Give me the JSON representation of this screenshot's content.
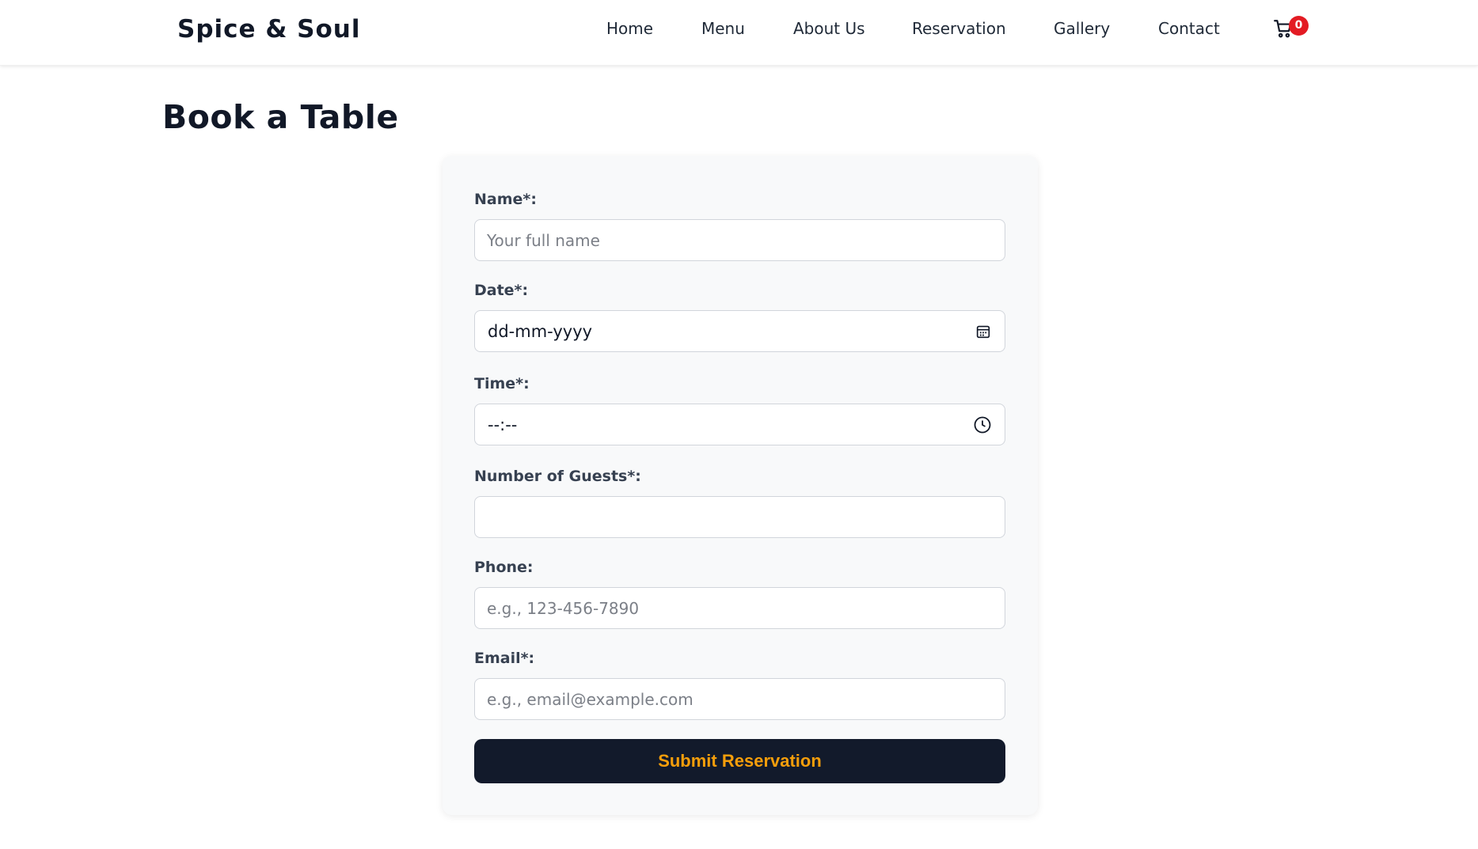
{
  "header": {
    "brand": "Spice & Soul",
    "nav": [
      "Home",
      "Menu",
      "About Us",
      "Reservation",
      "Gallery",
      "Contact"
    ],
    "cart_count": "0",
    "cart_icon": "cart-icon",
    "cart_badge_color": "#e31b23"
  },
  "page": {
    "title": "Book a Table"
  },
  "form": {
    "name": {
      "label": "Name*:",
      "placeholder": "Your full name"
    },
    "date": {
      "label": "Date*:",
      "value": "dd-mm-yyyy",
      "icon": "calendar-icon"
    },
    "time": {
      "label": "Time*:",
      "value": "--:--",
      "icon": "clock-icon"
    },
    "guests": {
      "label": "Number of Guests*:",
      "value": ""
    },
    "phone": {
      "label": "Phone:",
      "placeholder": "e.g., 123-456-7890"
    },
    "email": {
      "label": "Email*:",
      "placeholder": "e.g., email@example.com"
    },
    "submit_label": "Submit Reservation",
    "submit_bg": "#121a2b",
    "submit_text_color": "#f59e0b"
  }
}
